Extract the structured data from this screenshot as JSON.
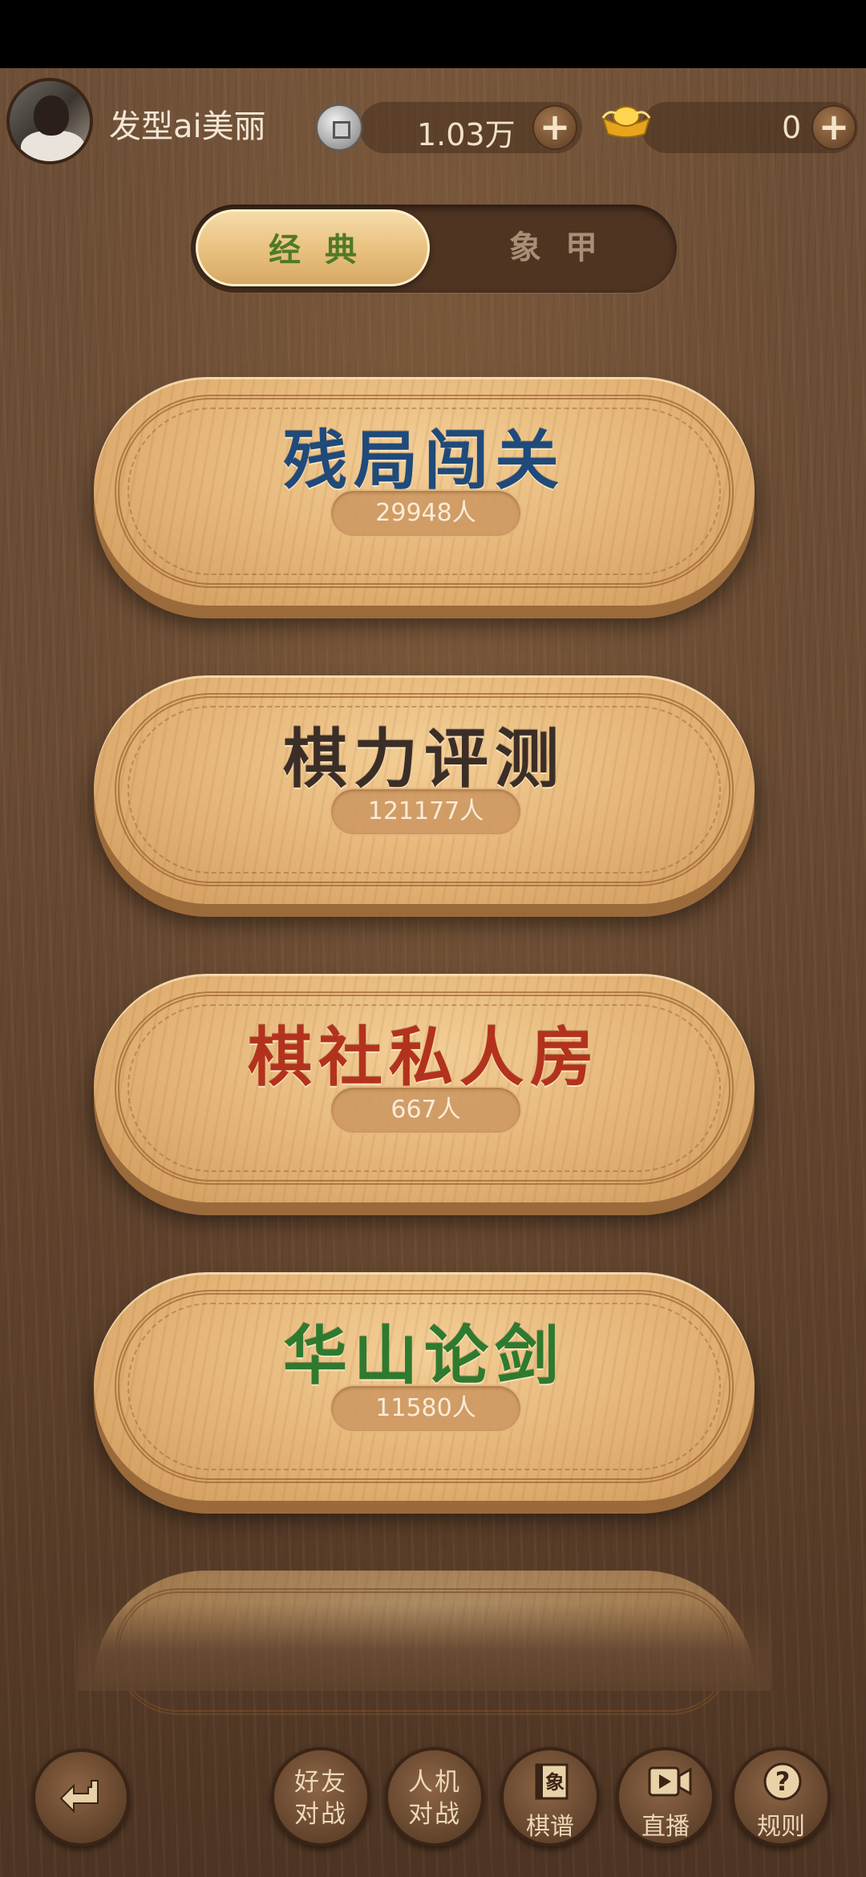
{
  "header": {
    "username": "发型ai美丽",
    "coin_amount": "1.03万",
    "gold_amount": "0",
    "plus_symbol": "+",
    "coin_icon": "copper-coin-icon",
    "gold_icon": "gold-ingot-icon"
  },
  "mode_tabs": [
    {
      "label": "经典",
      "active": true
    },
    {
      "label": "象甲",
      "active": false
    }
  ],
  "menu": [
    {
      "title": "残局闯关",
      "count": "29948人",
      "color": "#1f4a7a"
    },
    {
      "title": "棋力评测",
      "count": "121177人",
      "color": "#3b2e27"
    },
    {
      "title": "棋社私人房",
      "count": "667人",
      "color": "#b3321d"
    },
    {
      "title": "华山论剑",
      "count": "11580人",
      "color": "#2e7a2f"
    }
  ],
  "bottom_nav": {
    "friends": {
      "line1": "好友",
      "line2": "对战"
    },
    "ai": {
      "line1": "人机",
      "line2": "对战"
    },
    "record": {
      "label": "棋谱",
      "icon_char": "象"
    },
    "live": {
      "label": "直播"
    },
    "rules": {
      "label": "规则",
      "icon_char": "?"
    }
  },
  "colors": {
    "accent_green": "#4f7a26",
    "wood_light": "#f3cf96",
    "wood_dark": "#5b3f2a"
  }
}
